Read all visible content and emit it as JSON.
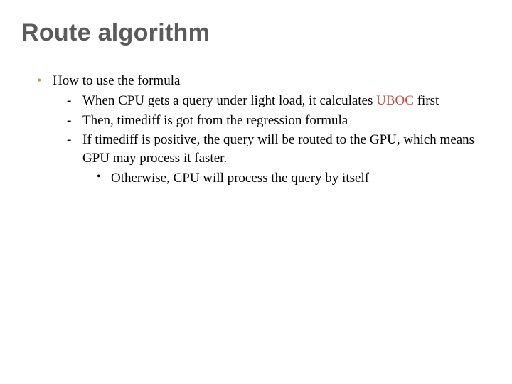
{
  "title": "Route algorithm",
  "bullets": {
    "main": "How to use the formula",
    "subs": [
      {
        "pre": "When CPU gets a query under light load, it calculates ",
        "em": "UBOC",
        "post": " first"
      },
      {
        "pre": "Then, timediff is got from the regression formula",
        "em": "",
        "post": ""
      },
      {
        "pre": "If timediff is positive, the query will be routed to the GPU, which means GPU may process it faster.",
        "em": "",
        "post": ""
      }
    ],
    "subsub": "Otherwise, CPU will process the query by itself"
  }
}
